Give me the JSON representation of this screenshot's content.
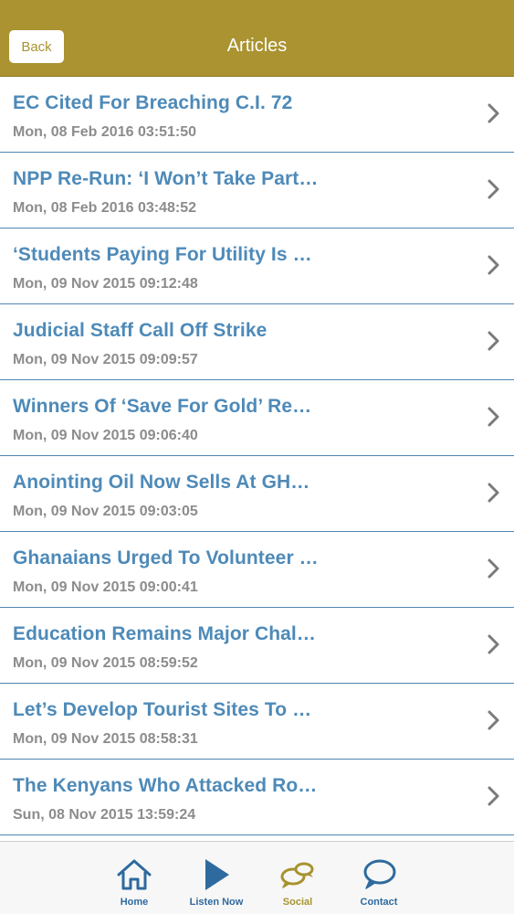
{
  "header": {
    "back_label": "Back",
    "title": "Articles",
    "bar_color": "#aa9330"
  },
  "articles": [
    {
      "title": "EC Cited For Breaching C.I. 72",
      "date": "Mon, 08 Feb 2016 03:51:50"
    },
    {
      "title": "NPP Re-Run: ‘I Won’t Take Part…",
      "date": "Mon, 08 Feb 2016 03:48:52"
    },
    {
      "title": "‘Students Paying For Utility Is …",
      "date": "Mon, 09 Nov 2015 09:12:48"
    },
    {
      "title": "Judicial Staff Call Off Strike",
      "date": "Mon, 09 Nov 2015 09:09:57"
    },
    {
      "title": "Winners Of ‘Save For Gold’ Re…",
      "date": "Mon, 09 Nov 2015 09:06:40"
    },
    {
      "title": "Anointing Oil Now Sells At GH…",
      "date": "Mon, 09 Nov 2015 09:03:05"
    },
    {
      "title": "Ghanaians Urged To Volunteer …",
      "date": "Mon, 09 Nov 2015 09:00:41"
    },
    {
      "title": "Education Remains Major Chal…",
      "date": "Mon, 09 Nov 2015 08:59:52"
    },
    {
      "title": "Let’s Develop Tourist Sites To …",
      "date": "Mon, 09 Nov 2015 08:58:31"
    },
    {
      "title": "The Kenyans Who Attacked Ro…",
      "date": "Sun, 08 Nov 2015 13:59:24"
    }
  ],
  "tabs": [
    {
      "label": "Home",
      "icon": "home-icon",
      "color": "#2e6a9e"
    },
    {
      "label": "Listen Now",
      "icon": "play-icon",
      "color": "#2e6a9e"
    },
    {
      "label": "Social",
      "icon": "chat-bubbles-icon",
      "color": "#a89230"
    },
    {
      "label": "Contact",
      "icon": "speech-bubble-icon",
      "color": "#2e6a9e"
    }
  ],
  "colors": {
    "title_text": "#4e8ab8",
    "date_text": "#8c8c8c",
    "separator": "#4f86b3",
    "tab_active": "#a89230",
    "tab_inactive": "#2e6a9e"
  }
}
